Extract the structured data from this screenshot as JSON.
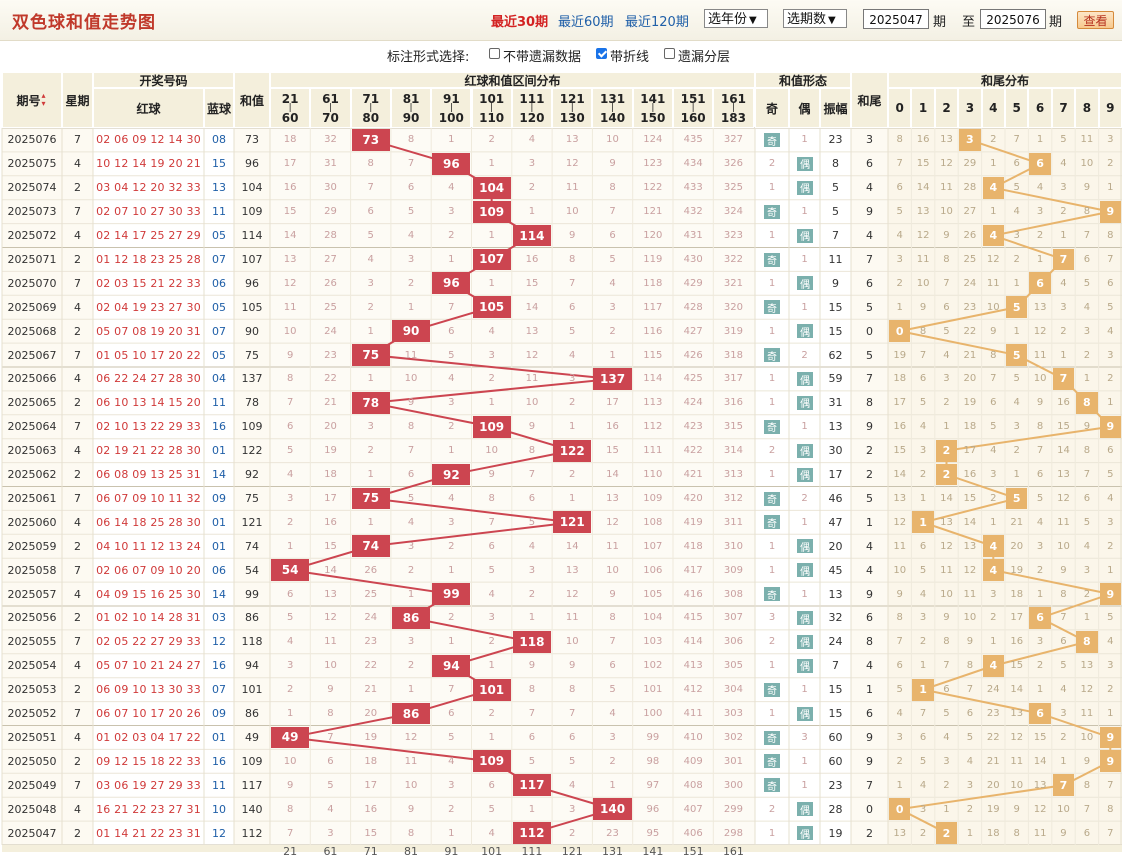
{
  "header": {
    "title": "双色球和值走势图",
    "ranges": [
      "最近30期",
      "最近60期",
      "最近120期"
    ],
    "active_range": 0,
    "year_select": "选年份",
    "period_select": "选期数",
    "from_value": "2025047",
    "from_unit": "期",
    "to_label": "至",
    "to_value": "2025076",
    "to_unit": "期",
    "query_button": "查看"
  },
  "options": {
    "label": "标注形式选择:",
    "items": [
      {
        "label": "不带遗漏数据",
        "checked": false
      },
      {
        "label": "带折线",
        "checked": true
      },
      {
        "label": "遗漏分层",
        "checked": false
      }
    ]
  },
  "columns": {
    "period": "期号",
    "week": "星期",
    "draw_group": "开奖号码",
    "red": "红球",
    "blue": "蓝球",
    "sum": "和值",
    "interval_group": "红球和值区间分布",
    "intervals": [
      [
        "21",
        "60"
      ],
      [
        "61",
        "70"
      ],
      [
        "71",
        "80"
      ],
      [
        "81",
        "90"
      ],
      [
        "91",
        "100"
      ],
      [
        "101",
        "110"
      ],
      [
        "111",
        "120"
      ],
      [
        "121",
        "130"
      ],
      [
        "131",
        "140"
      ],
      [
        "141",
        "150"
      ],
      [
        "151",
        "160"
      ],
      [
        "161",
        "183"
      ]
    ],
    "form_group": "和值形态",
    "odd": "奇",
    "even": "偶",
    "amplitude": "振幅",
    "tail": "和尾",
    "tail_group": "和尾分布",
    "tail_digits": [
      "0",
      "1",
      "2",
      "3",
      "4",
      "5",
      "6",
      "7",
      "8",
      "9"
    ],
    "odd_mark": "奇",
    "even_mark": "偶"
  },
  "chart_data": {
    "type": "table",
    "rows": [
      {
        "period": "2025076",
        "week": "7",
        "red": "02 06 09 12 14 30",
        "blue": "08",
        "sum": 73,
        "iv": [
          18,
          32,
          73,
          8,
          1,
          2,
          4,
          13,
          10,
          124,
          435,
          327
        ],
        "odd": "奇",
        "even": "1",
        "amp": "23",
        "tail": "3",
        "td": [
          8,
          16,
          13,
          3,
          2,
          7,
          1,
          5,
          11,
          3
        ]
      },
      {
        "period": "2025075",
        "week": "4",
        "red": "10 12 14 19 20 21",
        "blue": "15",
        "sum": 96,
        "iv": [
          17,
          31,
          8,
          7,
          96,
          1,
          3,
          12,
          9,
          123,
          434,
          326
        ],
        "odd": "2",
        "even": "偶",
        "amp": "8",
        "tail": "6",
        "td": [
          7,
          15,
          12,
          29,
          1,
          6,
          6,
          4,
          10,
          2
        ]
      },
      {
        "period": "2025074",
        "week": "2",
        "red": "03 04 12 20 32 33",
        "blue": "13",
        "sum": 104,
        "iv": [
          16,
          30,
          7,
          6,
          4,
          104,
          2,
          11,
          8,
          122,
          433,
          325
        ],
        "odd": "1",
        "even": "偶",
        "amp": "5",
        "tail": "4",
        "td": [
          6,
          14,
          11,
          28,
          4,
          5,
          4,
          3,
          9,
          1
        ]
      },
      {
        "period": "2025073",
        "week": "7",
        "red": "02 07 10 27 30 33",
        "blue": "11",
        "sum": 109,
        "iv": [
          15,
          29,
          6,
          5,
          3,
          109,
          1,
          10,
          7,
          121,
          432,
          324
        ],
        "odd": "奇",
        "even": "1",
        "amp": "5",
        "tail": "9",
        "td": [
          5,
          13,
          10,
          27,
          1,
          4,
          3,
          2,
          8,
          9
        ]
      },
      {
        "period": "2025072",
        "week": "4",
        "red": "02 14 17 25 27 29",
        "blue": "05",
        "sum": 114,
        "iv": [
          14,
          28,
          5,
          4,
          2,
          1,
          114,
          9,
          6,
          120,
          431,
          323
        ],
        "odd": "1",
        "even": "偶",
        "amp": "7",
        "tail": "4",
        "td": [
          4,
          12,
          9,
          26,
          4,
          3,
          2,
          1,
          7,
          8
        ]
      },
      {
        "period": "2025071",
        "week": "2",
        "red": "01 12 18 23 25 28",
        "blue": "07",
        "sum": 107,
        "iv": [
          13,
          27,
          4,
          3,
          1,
          107,
          16,
          8,
          5,
          119,
          430,
          322
        ],
        "odd": "奇",
        "even": "1",
        "amp": "11",
        "tail": "7",
        "td": [
          3,
          11,
          8,
          25,
          12,
          2,
          1,
          7,
          6,
          7
        ]
      },
      {
        "period": "2025070",
        "week": "7",
        "red": "02 03 15 21 22 33",
        "blue": "06",
        "sum": 96,
        "iv": [
          12,
          26,
          3,
          2,
          96,
          1,
          15,
          7,
          4,
          118,
          429,
          321
        ],
        "odd": "1",
        "even": "偶",
        "amp": "9",
        "tail": "6",
        "td": [
          2,
          10,
          7,
          24,
          11,
          1,
          6,
          4,
          5,
          6
        ]
      },
      {
        "period": "2025069",
        "week": "4",
        "red": "02 04 19 23 27 30",
        "blue": "05",
        "sum": 105,
        "iv": [
          11,
          25,
          2,
          1,
          7,
          105,
          14,
          6,
          3,
          117,
          428,
          320
        ],
        "odd": "奇",
        "even": "1",
        "amp": "15",
        "tail": "5",
        "td": [
          1,
          9,
          6,
          23,
          10,
          5,
          13,
          3,
          4,
          5
        ]
      },
      {
        "period": "2025068",
        "week": "2",
        "red": "05 07 08 19 20 31",
        "blue": "07",
        "sum": 90,
        "iv": [
          10,
          24,
          1,
          90,
          6,
          4,
          13,
          5,
          2,
          116,
          427,
          319
        ],
        "odd": "1",
        "even": "偶",
        "amp": "15",
        "tail": "0",
        "td": [
          0,
          8,
          5,
          22,
          9,
          1,
          12,
          2,
          3,
          4
        ]
      },
      {
        "period": "2025067",
        "week": "7",
        "red": "01 05 10 17 20 22",
        "blue": "05",
        "sum": 75,
        "iv": [
          9,
          23,
          75,
          11,
          5,
          3,
          12,
          4,
          1,
          115,
          426,
          318
        ],
        "odd": "奇",
        "even": "2",
        "amp": "62",
        "tail": "5",
        "td": [
          19,
          7,
          4,
          21,
          8,
          5,
          11,
          1,
          2,
          3
        ]
      },
      {
        "period": "2025066",
        "week": "4",
        "red": "06 22 24 27 28 30",
        "blue": "04",
        "sum": 137,
        "iv": [
          8,
          22,
          1,
          10,
          4,
          2,
          11,
          3,
          137,
          114,
          425,
          317
        ],
        "odd": "1",
        "even": "偶",
        "amp": "59",
        "tail": "7",
        "td": [
          18,
          6,
          3,
          20,
          7,
          5,
          10,
          7,
          1,
          2
        ]
      },
      {
        "period": "2025065",
        "week": "2",
        "red": "06 10 13 14 15 20",
        "blue": "11",
        "sum": 78,
        "iv": [
          7,
          21,
          78,
          9,
          3,
          1,
          10,
          2,
          17,
          113,
          424,
          316
        ],
        "odd": "1",
        "even": "偶",
        "amp": "31",
        "tail": "8",
        "td": [
          17,
          5,
          2,
          19,
          6,
          4,
          9,
          16,
          8,
          1
        ]
      },
      {
        "period": "2025064",
        "week": "7",
        "red": "02 10 13 22 29 33",
        "blue": "16",
        "sum": 109,
        "iv": [
          6,
          20,
          3,
          8,
          2,
          109,
          9,
          1,
          16,
          112,
          423,
          315
        ],
        "odd": "奇",
        "even": "1",
        "amp": "13",
        "tail": "9",
        "td": [
          16,
          4,
          1,
          18,
          5,
          3,
          8,
          15,
          9,
          9
        ]
      },
      {
        "period": "2025063",
        "week": "4",
        "red": "02 19 21 22 28 30",
        "blue": "01",
        "sum": 122,
        "iv": [
          5,
          19,
          2,
          7,
          1,
          10,
          8,
          122,
          15,
          111,
          422,
          314
        ],
        "odd": "2",
        "even": "偶",
        "amp": "30",
        "tail": "2",
        "td": [
          15,
          3,
          2,
          17,
          4,
          2,
          7,
          14,
          8,
          6
        ]
      },
      {
        "period": "2025062",
        "week": "2",
        "red": "06 08 09 13 25 31",
        "blue": "14",
        "sum": 92,
        "iv": [
          4,
          18,
          1,
          6,
          92,
          9,
          7,
          2,
          14,
          110,
          421,
          313
        ],
        "odd": "1",
        "even": "偶",
        "amp": "17",
        "tail": "2",
        "td": [
          14,
          2,
          2,
          16,
          3,
          1,
          6,
          13,
          7,
          5
        ]
      },
      {
        "period": "2025061",
        "week": "7",
        "red": "06 07 09 10 11 32",
        "blue": "09",
        "sum": 75,
        "iv": [
          3,
          17,
          75,
          5,
          4,
          8,
          6,
          1,
          13,
          109,
          420,
          312
        ],
        "odd": "奇",
        "even": "2",
        "amp": "46",
        "tail": "5",
        "td": [
          13,
          1,
          14,
          15,
          2,
          5,
          5,
          12,
          6,
          4
        ]
      },
      {
        "period": "2025060",
        "week": "4",
        "red": "06 14 18 25 28 30",
        "blue": "01",
        "sum": 121,
        "iv": [
          2,
          16,
          1,
          4,
          3,
          7,
          5,
          121,
          12,
          108,
          419,
          311
        ],
        "odd": "奇",
        "even": "1",
        "amp": "47",
        "tail": "1",
        "td": [
          12,
          1,
          13,
          14,
          1,
          21,
          4,
          11,
          5,
          3
        ]
      },
      {
        "period": "2025059",
        "week": "2",
        "red": "04 10 11 12 13 24",
        "blue": "01",
        "sum": 74,
        "iv": [
          1,
          15,
          74,
          3,
          2,
          6,
          4,
          14,
          11,
          107,
          418,
          310
        ],
        "odd": "1",
        "even": "偶",
        "amp": "20",
        "tail": "4",
        "td": [
          11,
          6,
          12,
          13,
          4,
          20,
          3,
          10,
          4,
          2
        ]
      },
      {
        "period": "2025058",
        "week": "7",
        "red": "02 06 07 09 10 20",
        "blue": "06",
        "sum": 54,
        "iv": [
          54,
          14,
          26,
          2,
          1,
          5,
          3,
          13,
          10,
          106,
          417,
          309
        ],
        "odd": "1",
        "even": "偶",
        "amp": "45",
        "tail": "4",
        "td": [
          10,
          5,
          11,
          12,
          4,
          19,
          2,
          9,
          3,
          1
        ]
      },
      {
        "period": "2025057",
        "week": "4",
        "red": "04 09 15 16 25 30",
        "blue": "14",
        "sum": 99,
        "iv": [
          6,
          13,
          25,
          1,
          99,
          4,
          2,
          12,
          9,
          105,
          416,
          308
        ],
        "odd": "奇",
        "even": "1",
        "amp": "13",
        "tail": "9",
        "td": [
          9,
          4,
          10,
          11,
          3,
          18,
          1,
          8,
          2,
          9
        ]
      },
      {
        "period": "2025056",
        "week": "2",
        "red": "01 02 10 14 28 31",
        "blue": "03",
        "sum": 86,
        "iv": [
          5,
          12,
          24,
          86,
          2,
          3,
          1,
          11,
          8,
          104,
          415,
          307
        ],
        "odd": "3",
        "even": "偶",
        "amp": "32",
        "tail": "6",
        "td": [
          8,
          3,
          9,
          10,
          2,
          17,
          6,
          7,
          1,
          5
        ]
      },
      {
        "period": "2025055",
        "week": "7",
        "red": "02 05 22 27 29 33",
        "blue": "12",
        "sum": 118,
        "iv": [
          4,
          11,
          23,
          3,
          1,
          2,
          118,
          10,
          7,
          103,
          414,
          306
        ],
        "odd": "2",
        "even": "偶",
        "amp": "24",
        "tail": "8",
        "td": [
          7,
          2,
          8,
          9,
          1,
          16,
          3,
          6,
          8,
          4
        ]
      },
      {
        "period": "2025054",
        "week": "4",
        "red": "05 07 10 21 24 27",
        "blue": "16",
        "sum": 94,
        "iv": [
          3,
          10,
          22,
          2,
          94,
          1,
          9,
          9,
          6,
          102,
          413,
          305
        ],
        "odd": "1",
        "even": "偶",
        "amp": "7",
        "tail": "4",
        "td": [
          6,
          1,
          7,
          8,
          4,
          15,
          2,
          5,
          13,
          3
        ]
      },
      {
        "period": "2025053",
        "week": "2",
        "red": "06 09 10 13 30 33",
        "blue": "07",
        "sum": 101,
        "iv": [
          2,
          9,
          21,
          1,
          7,
          101,
          8,
          8,
          5,
          101,
          412,
          304
        ],
        "odd": "奇",
        "even": "1",
        "amp": "15",
        "tail": "1",
        "td": [
          5,
          1,
          6,
          7,
          24,
          14,
          1,
          4,
          12,
          2
        ]
      },
      {
        "period": "2025052",
        "week": "7",
        "red": "06 07 10 17 20 26",
        "blue": "09",
        "sum": 86,
        "iv": [
          1,
          8,
          20,
          86,
          6,
          2,
          7,
          7,
          4,
          100,
          411,
          303
        ],
        "odd": "1",
        "even": "偶",
        "amp": "15",
        "tail": "6",
        "td": [
          4,
          7,
          5,
          6,
          23,
          13,
          6,
          3,
          11,
          1
        ]
      },
      {
        "period": "2025051",
        "week": "4",
        "red": "01 02 03 04 17 22",
        "blue": "01",
        "sum": 49,
        "iv": [
          49,
          7,
          19,
          12,
          5,
          1,
          6,
          6,
          3,
          99,
          410,
          302
        ],
        "odd": "奇",
        "even": "3",
        "amp": "60",
        "tail": "9",
        "td": [
          3,
          6,
          4,
          5,
          22,
          12,
          15,
          2,
          10,
          9
        ]
      },
      {
        "period": "2025050",
        "week": "2",
        "red": "09 12 15 18 22 33",
        "blue": "16",
        "sum": 109,
        "iv": [
          10,
          6,
          18,
          11,
          4,
          109,
          5,
          5,
          2,
          98,
          409,
          301
        ],
        "odd": "奇",
        "even": "1",
        "amp": "60",
        "tail": "9",
        "td": [
          2,
          5,
          3,
          4,
          21,
          11,
          14,
          1,
          9,
          9
        ]
      },
      {
        "period": "2025049",
        "week": "7",
        "red": "03 06 19 27 29 33",
        "blue": "11",
        "sum": 117,
        "iv": [
          9,
          5,
          17,
          10,
          3,
          6,
          117,
          4,
          1,
          97,
          408,
          300
        ],
        "odd": "奇",
        "even": "1",
        "amp": "23",
        "tail": "7",
        "td": [
          1,
          4,
          2,
          3,
          20,
          10,
          13,
          7,
          8,
          7
        ]
      },
      {
        "period": "2025048",
        "week": "4",
        "red": "16 21 22 23 27 31",
        "blue": "10",
        "sum": 140,
        "iv": [
          8,
          4,
          16,
          9,
          2,
          5,
          1,
          3,
          140,
          96,
          407,
          299
        ],
        "odd": "2",
        "even": "偶",
        "amp": "28",
        "tail": "0",
        "td": [
          0,
          3,
          1,
          2,
          19,
          9,
          12,
          10,
          7,
          8
        ]
      },
      {
        "period": "2025047",
        "week": "2",
        "red": "01 14 21 22 23 31",
        "blue": "12",
        "sum": 112,
        "iv": [
          7,
          3,
          15,
          8,
          1,
          4,
          112,
          2,
          23,
          95,
          406,
          298
        ],
        "odd": "1",
        "even": "偶",
        "amp": "19",
        "tail": "2",
        "td": [
          13,
          2,
          2,
          1,
          18,
          8,
          11,
          9,
          6,
          7
        ]
      }
    ]
  },
  "colors": {
    "red_ball": "#d03a3a",
    "blue_ball": "#1f5fa8",
    "interval_hit": "#cc4550",
    "interval_line": "#cc4550",
    "tail_hit": "#e8b46c",
    "tail_line": "#e8b46c",
    "odd_badge": "#7bb0ad",
    "even_badge": "#7bb0ad",
    "omit_text": "#c9a0a0",
    "header_bg": "#f4efdc"
  }
}
